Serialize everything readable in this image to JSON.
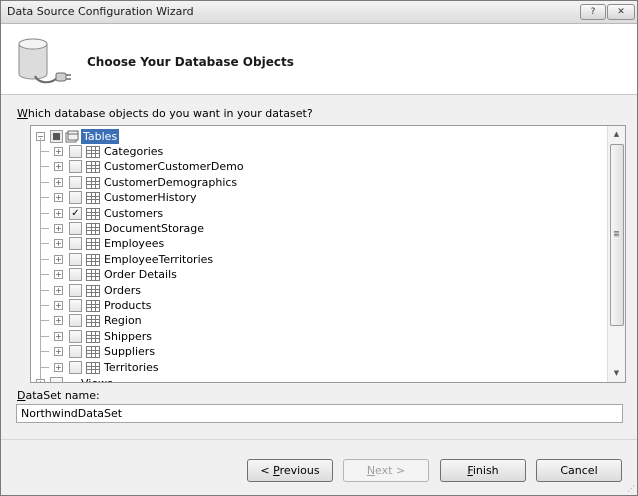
{
  "window": {
    "title": "Data Source Configuration Wizard",
    "help_label": "?",
    "close_label": "✕"
  },
  "header": {
    "title": "Choose Your Database Objects",
    "icon": "database-plug-icon"
  },
  "question": {
    "prefix": "W",
    "rest": "hich database objects do you want in your dataset?"
  },
  "tree": {
    "root_label": "Tables",
    "items": [
      {
        "label": "Categories",
        "checked": false
      },
      {
        "label": "CustomerCustomerDemo",
        "checked": false
      },
      {
        "label": "CustomerDemographics",
        "checked": false
      },
      {
        "label": "CustomerHistory",
        "checked": false
      },
      {
        "label": "Customers",
        "checked": true
      },
      {
        "label": "DocumentStorage",
        "checked": false
      },
      {
        "label": "Employees",
        "checked": false
      },
      {
        "label": "EmployeeTerritories",
        "checked": false
      },
      {
        "label": "Order Details",
        "checked": false
      },
      {
        "label": "Orders",
        "checked": false
      },
      {
        "label": "Products",
        "checked": false
      },
      {
        "label": "Region",
        "checked": false
      },
      {
        "label": "Shippers",
        "checked": false
      },
      {
        "label": "Suppliers",
        "checked": false
      },
      {
        "label": "Territories",
        "checked": false
      }
    ],
    "next_root_label": "Views"
  },
  "dataset": {
    "label_prefix": "D",
    "label_rest": "ataSet name:",
    "value": "NorthwindDataSet"
  },
  "buttons": {
    "previous": {
      "prefix": "< ",
      "mnemonic": "P",
      "rest": "revious"
    },
    "next": {
      "mnemonic": "N",
      "rest": "ext >"
    },
    "finish": {
      "mnemonic": "F",
      "rest": "inish"
    },
    "cancel": "Cancel"
  }
}
